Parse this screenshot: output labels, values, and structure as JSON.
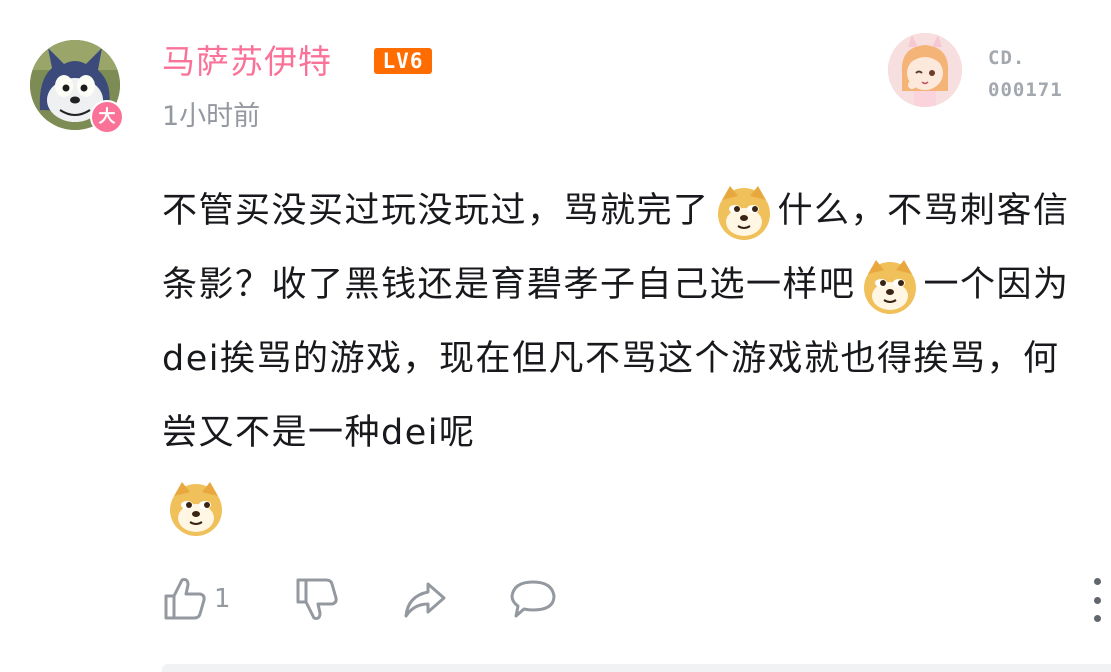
{
  "comment": {
    "author": {
      "name": "马萨苏伊特",
      "level_badge": "LV6",
      "avatar_tag": "急了",
      "big_member_badge": "大"
    },
    "time": "1小时前",
    "fan_badge": {
      "label": "CD.",
      "number": "000171"
    },
    "text": {
      "part1": "不管买没买过玩没玩过，骂就完了",
      "part2": "什么，不骂刺客信条影？收了黑钱还是育碧孝子自己选一样吧",
      "part3": "一个因为dei挨骂的游戏，现在但凡不骂这个游戏就也得挨骂，何尝又不是一种dei呢"
    },
    "emote": "doge-emote",
    "actions": {
      "like_count": "1"
    }
  },
  "colors": {
    "username": "#fb7299",
    "level": "#ff6c00",
    "muted": "#9499a0",
    "text": "#18191c"
  }
}
